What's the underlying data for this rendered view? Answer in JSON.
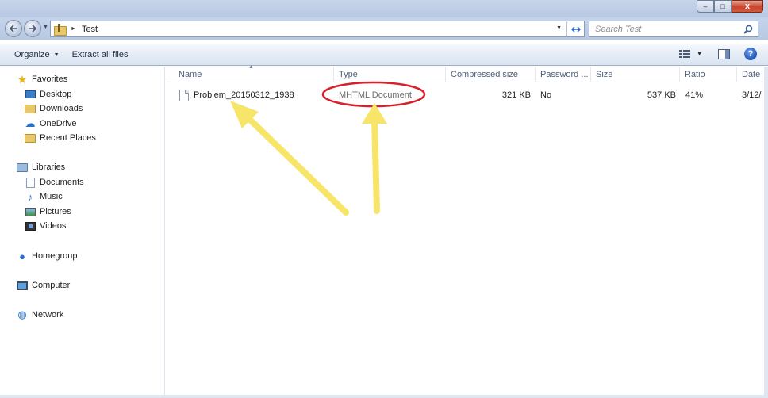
{
  "window": {
    "controls": {
      "minimize": "–",
      "maximize": "□",
      "close": "x"
    }
  },
  "address": {
    "back_icon": "back-arrow-icon",
    "forward_icon": "forward-arrow-icon",
    "path_separator": "►",
    "path": "Test",
    "dropdown": "▼",
    "refresh": "↻"
  },
  "search": {
    "placeholder": "Search Test"
  },
  "toolbar": {
    "organize_label": "Organize",
    "organize_caret": "▼",
    "extract_label": "Extract all files",
    "views_caret": "▼",
    "help_label": "?"
  },
  "nav": {
    "favorites": {
      "label": "Favorites",
      "items": [
        {
          "label": "Desktop",
          "icon": "desktop-icon"
        },
        {
          "label": "Downloads",
          "icon": "downloads-folder-icon"
        },
        {
          "label": "OneDrive",
          "icon": "cloud-icon"
        },
        {
          "label": "Recent Places",
          "icon": "recent-places-icon"
        }
      ]
    },
    "libraries": {
      "label": "Libraries",
      "items": [
        {
          "label": "Documents",
          "icon": "documents-icon"
        },
        {
          "label": "Music",
          "icon": "music-icon"
        },
        {
          "label": "Pictures",
          "icon": "pictures-icon"
        },
        {
          "label": "Videos",
          "icon": "videos-icon"
        }
      ]
    },
    "homegroup": "Homegroup",
    "computer": "Computer",
    "network": "Network"
  },
  "table": {
    "columns": [
      "Name",
      "Type",
      "Compressed size",
      "Password ...",
      "Size",
      "Ratio",
      "Date"
    ],
    "sort_indicator": "▲",
    "rows": [
      {
        "name": "Problem_20150312_1938",
        "type": "MHTML Document",
        "compressed_size": "321 KB",
        "password": "No",
        "size": "537 KB",
        "ratio": "41%",
        "date": "3/12/"
      }
    ]
  },
  "annotation_colors": {
    "circle": "#d8202a",
    "arrow": "#f7e56a"
  }
}
